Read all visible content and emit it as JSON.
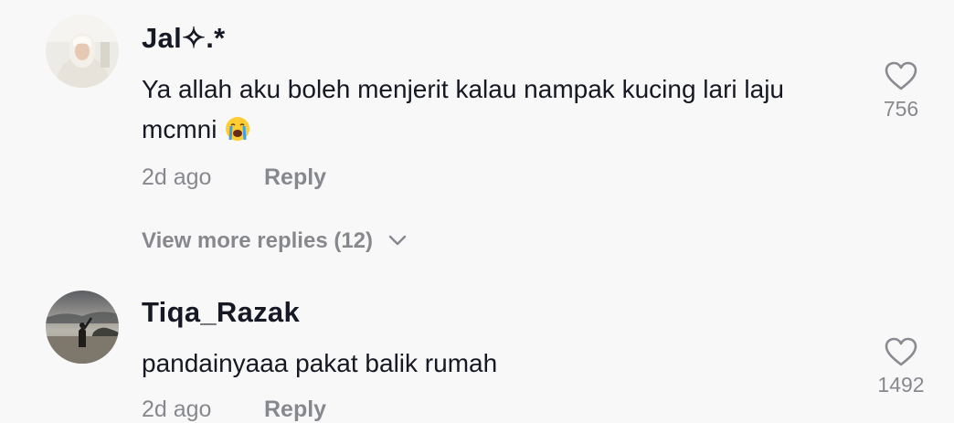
{
  "comments": [
    {
      "username": "Jal✧.*",
      "text": "Ya allah aku boleh menjerit kalau nampak kucing lari laju mcmni",
      "emoji_icon": "loudly-crying-face-emoji",
      "time": "2d ago",
      "reply_label": "Reply",
      "likes": "756",
      "avatar_icon": "user-avatar-photo"
    },
    {
      "username": "Tiqa_Razak",
      "text": "pandainyaaa pakat balik rumah",
      "time": "2d ago",
      "reply_label": "Reply",
      "likes": "1492",
      "avatar_icon": "user-avatar-photo"
    }
  ],
  "view_more": {
    "label": "View more replies (12)",
    "icon": "chevron-down-icon"
  },
  "colors": {
    "background": "#f8f8f8",
    "primary_text": "#161823",
    "secondary_text": "rgba(22,24,35,0.5)"
  }
}
